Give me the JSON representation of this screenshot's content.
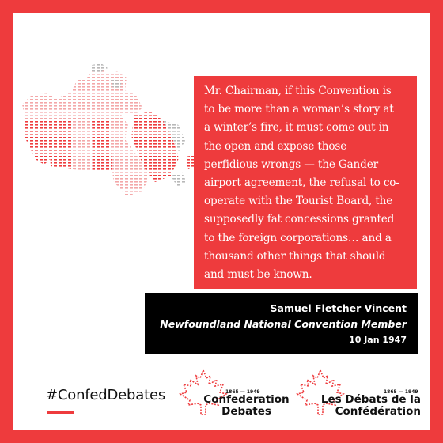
{
  "quote": {
    "lines": [
      "Mr. Chairman, if this Convention is",
      "to be more than a woman’s story at",
      "a winter’s fire, it must come out in",
      "the open and expose those",
      "perfidious wrongs — the Gander",
      "airport agreement, the refusal to co-",
      "operate with the Tourist Board, the",
      "supposedly fat concessions granted",
      "to the foreign corporations… and a",
      "thousand other things that should",
      "and must be known."
    ]
  },
  "attribution": {
    "name": "Samuel Fletcher Vincent",
    "role": "Newfoundland National Convention Member",
    "date": "10 Jan 1947"
  },
  "hashtag": "#ConfedDebates",
  "logo_en": {
    "years": "1865 — 1949",
    "title_line1": "Confederation",
    "title_line2": "Debates"
  },
  "logo_fr": {
    "years": "1865 — 1949",
    "title_line1": "Les Débats de la",
    "title_line2": "Confédération"
  },
  "icons": {
    "map": "canada-map-icon",
    "maple_leaf": "maple-leaf-outline-icon"
  },
  "colors": {
    "accent_red": "#ee3b3d",
    "attribution_bg": "#000000",
    "text_dark": "#111111"
  }
}
